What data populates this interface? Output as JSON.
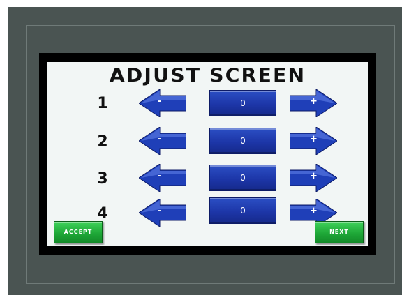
{
  "screen": {
    "title": "ADJUST SCREEN"
  },
  "rows": [
    {
      "label": "1",
      "minus": "-",
      "value": "0",
      "plus": "+"
    },
    {
      "label": "2",
      "minus": "-",
      "value": "0",
      "plus": "+"
    },
    {
      "label": "3",
      "minus": "-",
      "value": "0",
      "plus": "+"
    },
    {
      "label": "4",
      "minus": "-",
      "value": "0",
      "plus": "+"
    }
  ],
  "buttons": {
    "accept_label": "ACCEPT",
    "next_label": "NEXT"
  },
  "colors": {
    "bezel": "#4a5452",
    "screen_bg": "#f2f6f5",
    "arrow_blue": "#1f3fb8",
    "value_blue": "#1d36a8",
    "button_green": "#1fa838"
  },
  "icons": {
    "decrement": "left-arrow-icon",
    "increment": "right-arrow-icon"
  }
}
